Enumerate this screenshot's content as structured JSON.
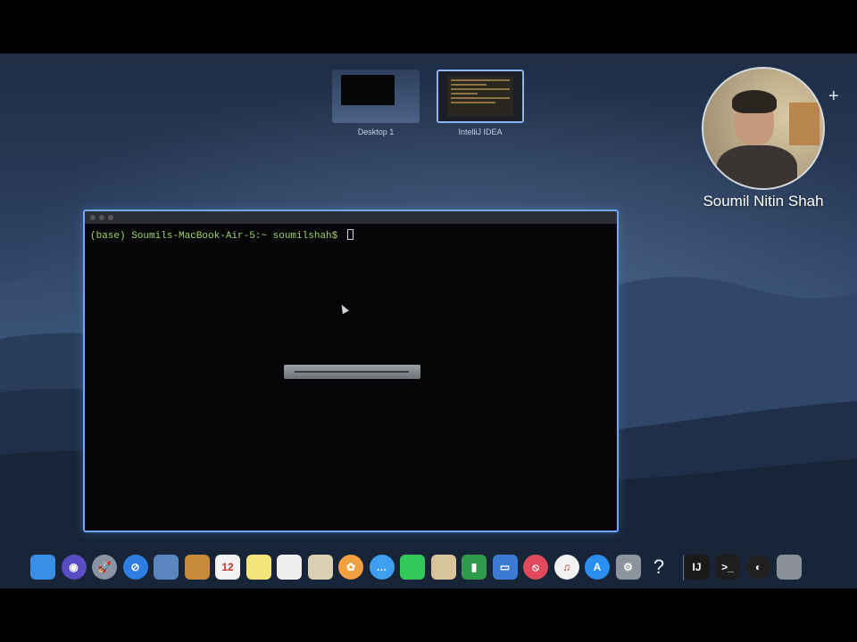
{
  "spaces_bar": {
    "spaces": [
      {
        "label": "Desktop 1"
      },
      {
        "label": "IntelliJ IDEA"
      }
    ]
  },
  "webcam": {
    "presenter_name": "Soumil Nitin Shah"
  },
  "terminal": {
    "prompt": "(base) Soumils-MacBook-Air-5:~ soumilshah$ ",
    "command": ""
  },
  "dock": {
    "icons": [
      {
        "name": "finder-icon",
        "color": "#3b8ee6",
        "glyph": ""
      },
      {
        "name": "siri-icon",
        "color": "#5b4bc4",
        "glyph": "◉"
      },
      {
        "name": "launchpad-icon",
        "color": "#8a93a1",
        "glyph": "🚀"
      },
      {
        "name": "safari-icon",
        "color": "#2f7de1",
        "glyph": "⊘"
      },
      {
        "name": "preview-icon",
        "color": "#5a86c0",
        "glyph": ""
      },
      {
        "name": "notes-book-icon",
        "color": "#c98a3a",
        "glyph": ""
      },
      {
        "name": "calendar-icon",
        "color": "#f2f2f2",
        "glyph": "12"
      },
      {
        "name": "notes-icon",
        "color": "#f5e47a",
        "glyph": ""
      },
      {
        "name": "textedit-icon",
        "color": "#eeeeee",
        "glyph": ""
      },
      {
        "name": "photos-app-icon",
        "color": "#d8d0b0",
        "glyph": ""
      },
      {
        "name": "photos-icon",
        "color": "#f0a040",
        "glyph": "✿"
      },
      {
        "name": "messages-icon",
        "color": "#3fa0f0",
        "glyph": "…"
      },
      {
        "name": "facetime-icon",
        "color": "#34c759",
        "glyph": ""
      },
      {
        "name": "contacts-icon",
        "color": "#d9c39a",
        "glyph": ""
      },
      {
        "name": "numbers-icon",
        "color": "#2e9a4a",
        "glyph": "▮"
      },
      {
        "name": "keynote-icon",
        "color": "#3c7bd4",
        "glyph": "▭"
      },
      {
        "name": "no-entry-icon",
        "color": "#e04a5c",
        "glyph": "⦸"
      },
      {
        "name": "music-icon",
        "color": "#f2f2f2",
        "glyph": "♫"
      },
      {
        "name": "app-store-icon",
        "color": "#2a8ff0",
        "glyph": "A"
      },
      {
        "name": "system-preferences-icon",
        "color": "#8d939c",
        "glyph": "⚙"
      },
      {
        "name": "help-icon",
        "color": "#00000000",
        "glyph": "?"
      },
      {
        "name": "intellij-icon",
        "color": "#1a1a1a",
        "glyph": "IJ"
      },
      {
        "name": "terminal-icon",
        "color": "#1e1e1e",
        "glyph": ">_"
      },
      {
        "name": "obs-icon",
        "color": "#202020",
        "glyph": "◐"
      },
      {
        "name": "trash-icon",
        "color": "#8b9097",
        "glyph": ""
      }
    ]
  }
}
